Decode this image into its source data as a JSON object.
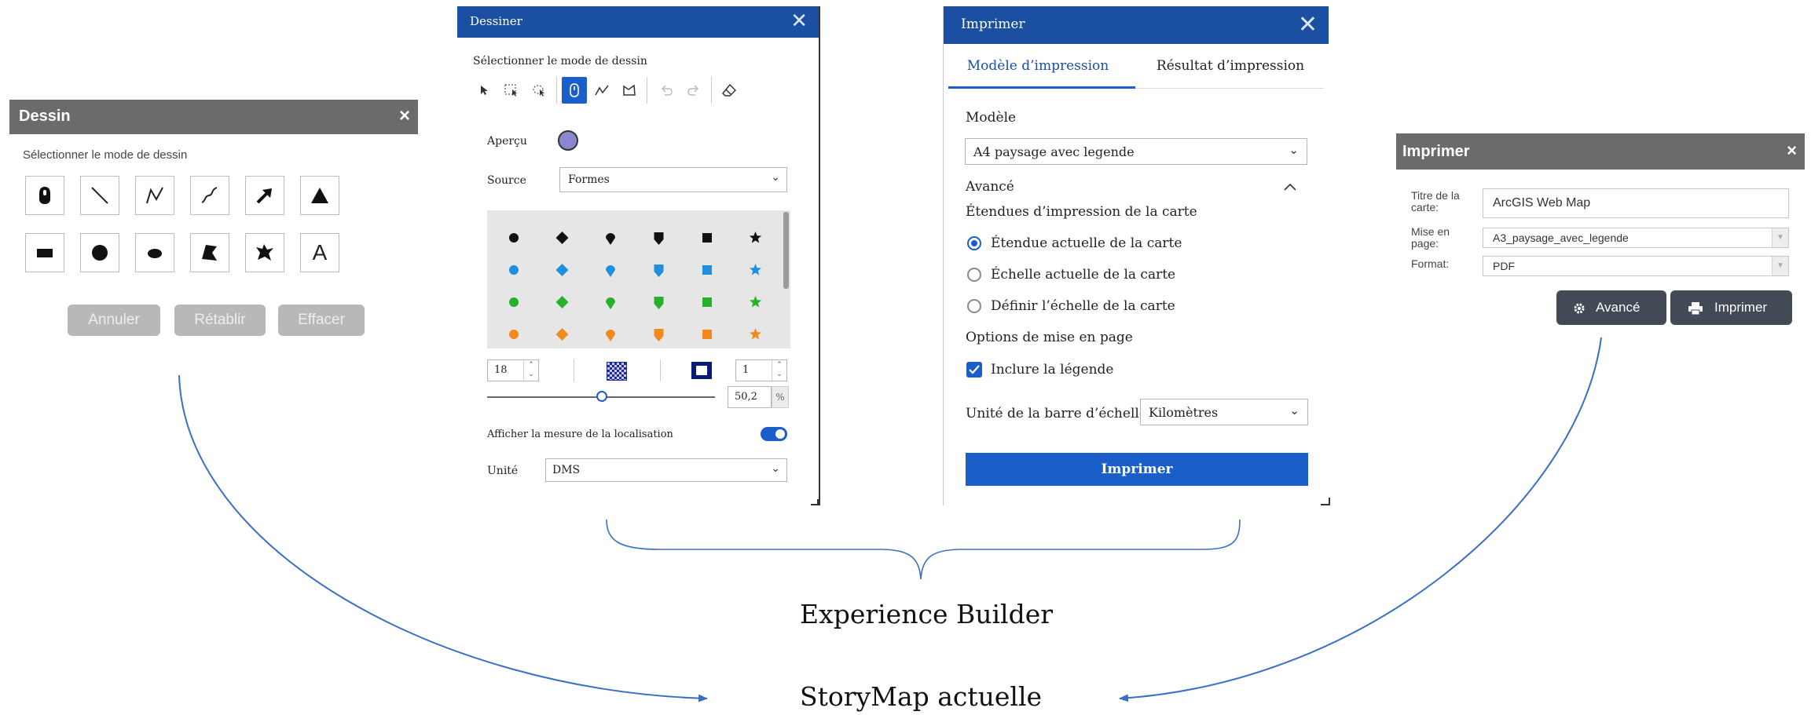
{
  "colors": {
    "grey_header": "#6b6b6b",
    "blue_header": "#1a4fa1",
    "accent_blue": "#1a5fc9",
    "arrow_blue": "#3a6fc6",
    "disabled_button": "#b8b8b8",
    "dark_button": "#414a55",
    "preview_color": "#8b87cf"
  },
  "dessin": {
    "title": "Dessin",
    "close_icon": "×",
    "subtitle": "Sélectionner le mode de dessin",
    "tools": [
      "point-icon",
      "line-icon",
      "polyline-icon",
      "freehand-line-icon",
      "arrow-icon",
      "triangle-icon",
      "rectangle-icon",
      "circle-icon",
      "ellipse-icon",
      "polygon-icon",
      "freehand-polygon-icon",
      "text-icon"
    ],
    "text_tool_label": "A",
    "buttons": {
      "cancel": "Annuler",
      "redo": "Rétablir",
      "clear": "Effacer"
    }
  },
  "dessiner": {
    "title": "Dessiner",
    "close_icon": "✕",
    "subtitle": "Sélectionner le mode de dessin",
    "preview_label": "Aperçu",
    "source_label": "Source",
    "source_value": "Formes",
    "size_value": "18",
    "outline_width_value": "1",
    "opacity_value": "50,2",
    "opacity_unit": "%",
    "show_measure_label": "Afficher la mesure de la localisation",
    "show_measure_on": true,
    "unit_label": "Unité",
    "unit_value": "DMS",
    "symbol_shapes": [
      "circle",
      "diamond",
      "pin",
      "square-pin",
      "square",
      "star"
    ],
    "symbol_colors": [
      "#111111",
      "#1f8fe0",
      "#27b02a",
      "#f08a1c"
    ]
  },
  "imprimer": {
    "title": "Imprimer",
    "close_icon": "✕",
    "tabs": [
      "Modèle d’impression",
      "Résultat d’impression"
    ],
    "active_tab": 0,
    "template_label": "Modèle",
    "template_value": "A4 paysage avec legende",
    "advanced_label": "Avancé",
    "extent_heading": "Étendues d’impression de la carte",
    "extent_options": [
      "Étendue actuelle de la carte",
      "Échelle actuelle de la carte",
      "Définir l’échelle de la carte"
    ],
    "extent_selected": 0,
    "layout_options_heading": "Options de mise en page",
    "include_legend_label": "Inclure la légende",
    "include_legend_checked": true,
    "scalebar_label": "Unité de la barre d’échelle",
    "scalebar_value": "Kilomètres",
    "print_button": "Imprimer"
  },
  "imprimer_old": {
    "title": "Imprimer",
    "close_icon": "×",
    "title_label": "Titre de la carte:",
    "title_value": "ArcGIS Web Map",
    "layout_label": "Mise en page:",
    "layout_value": "A3_paysage_avec_legende",
    "format_label": "Format:",
    "format_value": "PDF",
    "advanced_button": "Avancé",
    "print_button": "Imprimer"
  },
  "captions": {
    "experience_builder": "Experience Builder",
    "storymap": "StoryMap actuelle"
  }
}
